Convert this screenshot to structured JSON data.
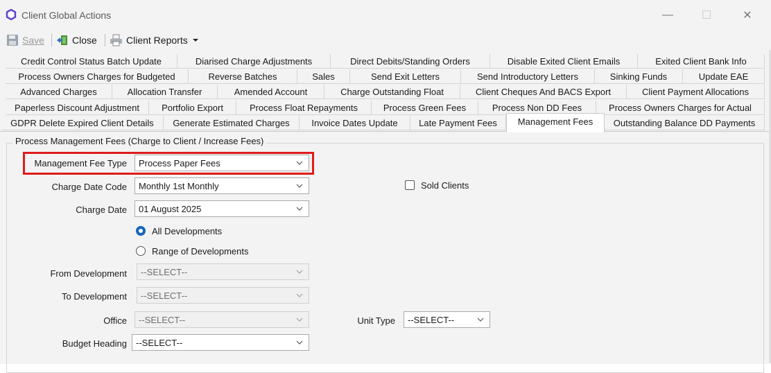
{
  "window": {
    "title": "Client Global Actions",
    "minimize_glyph": "—",
    "maximize_glyph": "☐",
    "close_glyph": "✕",
    "icon": "app-logo-icon"
  },
  "toolbar": {
    "save_label": "Save",
    "close_label": "Close",
    "client_reports_label": "Client Reports"
  },
  "tabs": {
    "row1": [
      "Credit Control Status Batch Update",
      "Diarised Charge Adjustments",
      "Direct Debits/Standing Orders",
      "Disable Exited Client Emails",
      "Exited Client Bank Info"
    ],
    "row2": [
      "Process Owners Charges for Budgeted",
      "Reverse  Batches",
      "Sales",
      "Send Exit Letters",
      "Send Introductory Letters",
      "Sinking Funds",
      "Update EAE"
    ],
    "row3": [
      "Advanced Charges",
      "Allocation Transfer",
      "Amended Account",
      "Charge Outstanding Float",
      "Client Cheques And BACS Export",
      "Client Payment Allocations"
    ],
    "row4": [
      "Paperless Discount Adjustment",
      "Portfolio Export",
      "Process Float Repayments",
      "Process Green Fees",
      "Process Non DD Fees",
      "Process Owners Charges for Actual"
    ],
    "row5": [
      "GDPR Delete Expired Client Details",
      "Generate Estimated Charges",
      "Invoice Dates Update",
      "Late Payment Fees",
      "Management Fees",
      "Outstanding Balance DD Payments"
    ],
    "active": "Management Fees"
  },
  "form": {
    "group_title": "Process Management Fees (Charge to Client / Increase Fees)",
    "fee_type_label": "Management Fee Type",
    "fee_type_value": "Process Paper Fees",
    "charge_date_code_label": "Charge Date Code",
    "charge_date_code_value": "Monthly 1st Monthly",
    "charge_date_label": "Charge Date",
    "charge_date_value": "01 August 2025",
    "all_developments_label": "All Developments",
    "range_developments_label": "Range of Developments",
    "from_development_label": "From Development",
    "from_development_value": "--SELECT--",
    "to_development_label": "To Development",
    "to_development_value": "--SELECT--",
    "office_label": "Office",
    "office_value": "--SELECT--",
    "unit_type_label": "Unit Type",
    "unit_type_value": "--SELECT--",
    "budget_heading_label": "Budget Heading",
    "budget_heading_value": "--SELECT--",
    "sold_clients_label": "Sold Clients",
    "sold_clients_checked": false,
    "selected_radio": "All Developments"
  },
  "colors": {
    "accent": "#1565c0",
    "highlight_border": "#e01b1b",
    "window_bg": "#f3f3f3"
  }
}
